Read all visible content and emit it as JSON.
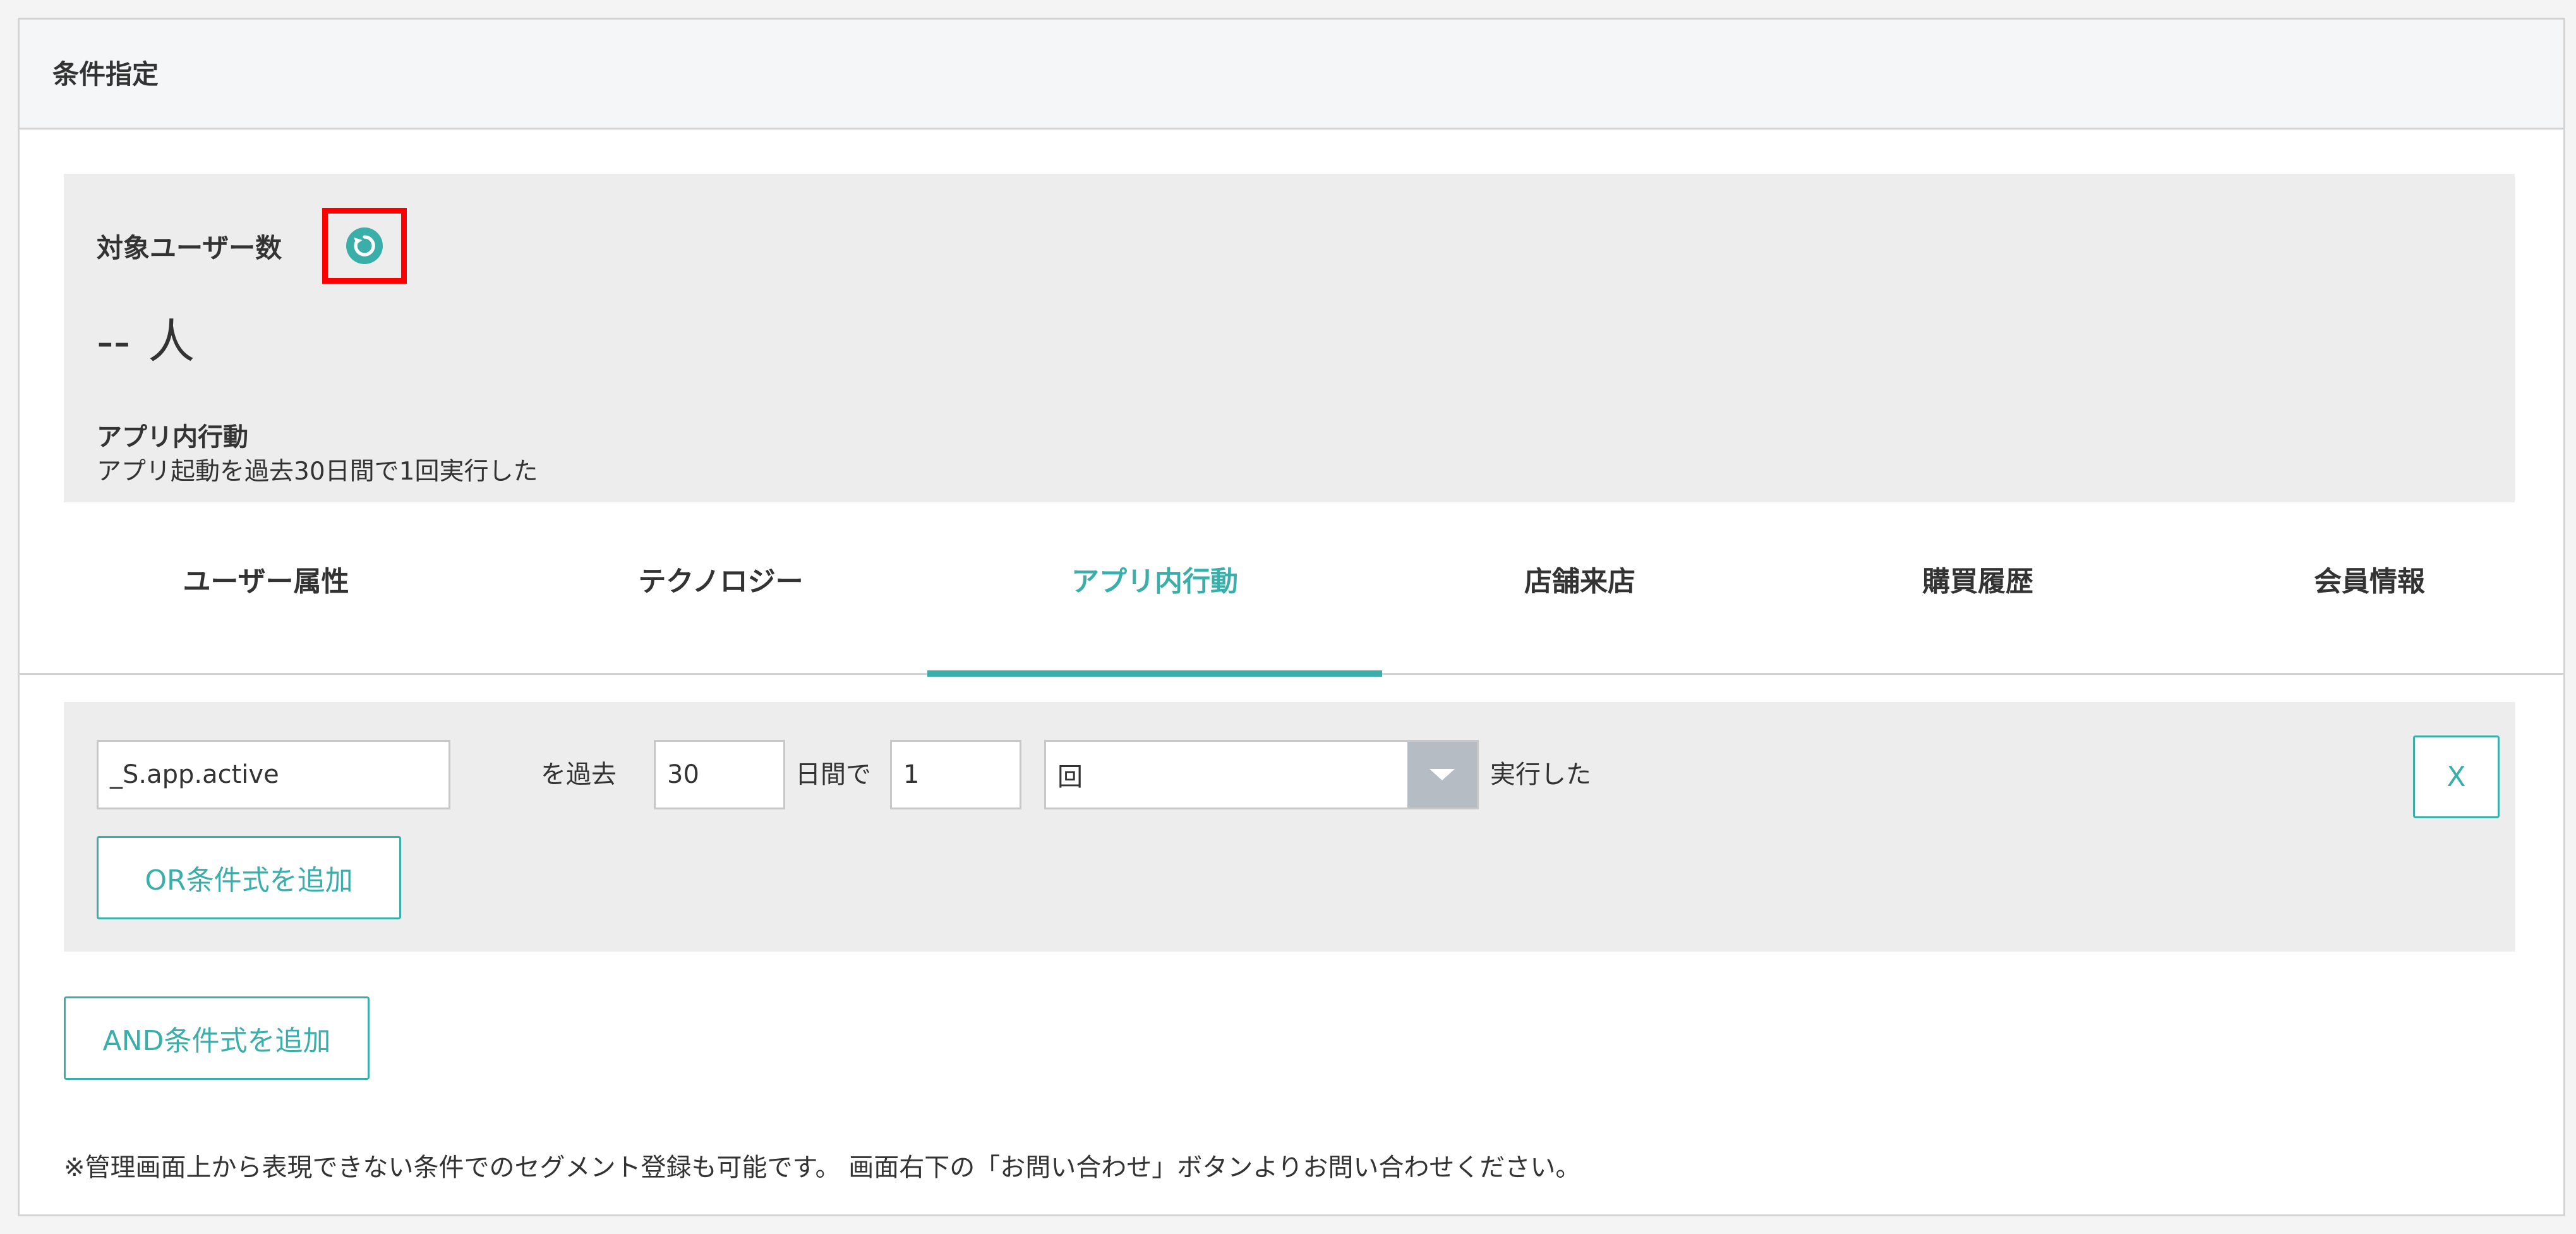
{
  "panel": {
    "title": "条件指定"
  },
  "summary": {
    "label": "対象ユーザー数",
    "refresh_icon": "refresh-icon",
    "count_value": "--",
    "count_unit": "人",
    "condition_title": "アプリ内行動",
    "condition_desc": "アプリ起動を過去30日間で1回実行した"
  },
  "tabs": [
    {
      "label": "ユーザー属性",
      "active": false
    },
    {
      "label": "テクノロジー",
      "active": false
    },
    {
      "label": "アプリ内行動",
      "active": true
    },
    {
      "label": "店舗来店",
      "active": false
    },
    {
      "label": "購買履歴",
      "active": false
    },
    {
      "label": "会員情報",
      "active": false
    }
  ],
  "rule": {
    "event_value": "_S.app.active",
    "text_past": "を過去",
    "days_value": "30",
    "text_days": "日間で",
    "times_value": "1",
    "unit_select": "回",
    "text_executed": "実行した",
    "remove_label": "X",
    "or_button": "OR条件式を追加"
  },
  "and_button": "AND条件式を追加",
  "footnote": "※管理画面上から表現できない条件でのセグメント登録も可能です。 画面右下の「お問い合わせ」ボタンよりお問い合わせください。",
  "colors": {
    "accent": "#3aafa9",
    "highlight": "#ff0000"
  }
}
